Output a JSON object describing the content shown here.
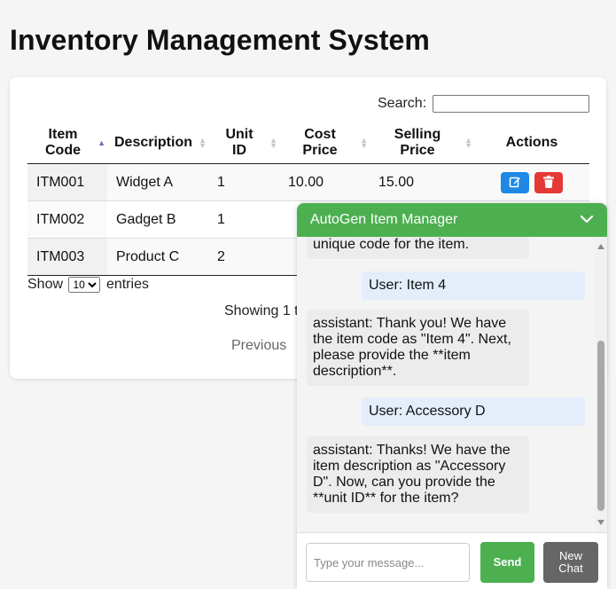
{
  "page": {
    "title": "Inventory Management System"
  },
  "search": {
    "label": "Search:",
    "value": ""
  },
  "table": {
    "columns": {
      "item_code": [
        "Item",
        "Code"
      ],
      "description": "Description",
      "unit_id": [
        "Unit",
        "ID"
      ],
      "cost_price": [
        "Cost",
        "Price"
      ],
      "selling_price": [
        "Selling",
        "Price"
      ],
      "actions": "Actions"
    },
    "rows": [
      {
        "item_code": "ITM001",
        "description": "Widget A",
        "unit_id": "1",
        "cost_price": "10.00",
        "selling_price": "15.00"
      },
      {
        "item_code": "ITM002",
        "description": "Gadget B",
        "unit_id": "1"
      },
      {
        "item_code": "ITM003",
        "description": "Product C",
        "unit_id": "2"
      }
    ]
  },
  "length_menu": {
    "prefix": "Show",
    "selected": "10",
    "suffix": "entries"
  },
  "info_text": "Showing 1 t",
  "pagination": {
    "previous": "Previous"
  },
  "chat": {
    "title": "AutoGen Item Manager",
    "messages": [
      {
        "role": "assistant",
        "text": "unique code for the item."
      },
      {
        "role": "user",
        "text": "User: Item 4"
      },
      {
        "role": "assistant",
        "text": "assistant: Thank you! We have the item code as \"Item 4\". Next, please provide the **item description**."
      },
      {
        "role": "user",
        "text": "User: Accessory D"
      },
      {
        "role": "assistant",
        "text": "assistant: Thanks! We have the item description as \"Accessory D\". Now, can you provide the **unit ID** for the item?"
      }
    ],
    "input_placeholder": "Type your message...",
    "send_label": "Send",
    "new_chat_label": [
      "New",
      "Chat"
    ]
  },
  "colors": {
    "chat_accent": "#4caf50",
    "edit_button": "#1e88e5",
    "delete_button": "#e53935",
    "new_chat_button": "#666666"
  },
  "icons": {
    "edit": "edit-icon",
    "delete": "trash-icon",
    "collapse": "chevron-down-icon",
    "sort": "sort-arrows-icon"
  }
}
